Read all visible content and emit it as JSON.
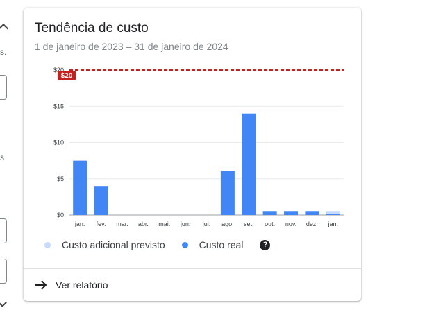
{
  "left_panel": {
    "text_1": "s.",
    "text_2": "s"
  },
  "card": {
    "title": "Tendência de custo",
    "subtitle": "1 de janeiro de 2023 – 31 de janeiro de 2024",
    "budget_label": "$20",
    "legend": [
      {
        "label": "Custo adicional previsto",
        "color": "#c6dafc"
      },
      {
        "label": "Custo real",
        "color": "#4285f4"
      }
    ],
    "help_icon": "?",
    "footer_link": "Ver relatório"
  },
  "colors": {
    "actual": "#4285f4",
    "forecast": "#c6dafc",
    "budget_line": "#c5221f"
  },
  "chart_data": {
    "type": "bar",
    "categories": [
      "jan.",
      "fev.",
      "mar.",
      "abr.",
      "mai.",
      "jun.",
      "jul.",
      "ago.",
      "set.",
      "out.",
      "nov.",
      "dez.",
      "jan."
    ],
    "series": [
      {
        "name": "Custo real",
        "values": [
          7.5,
          4,
          0,
          0,
          0,
          0,
          0,
          6.1,
          14,
          0.55,
          0.55,
          0.55,
          0.2
        ]
      },
      {
        "name": "Custo adicional previsto",
        "values": [
          0,
          0,
          0,
          0,
          0,
          0,
          0,
          0,
          0,
          0,
          0,
          0,
          0.35
        ]
      }
    ],
    "yticks": [
      "$0",
      "$5",
      "$10",
      "$15",
      "$20"
    ],
    "ylim": [
      0,
      20
    ],
    "budget": 20,
    "stacked": true,
    "grid": true
  }
}
